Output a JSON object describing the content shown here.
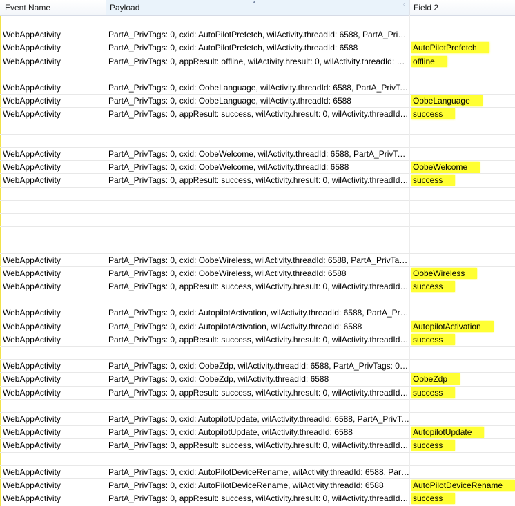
{
  "columns": {
    "event_name": "Event Name",
    "payload": "Payload",
    "field2": "Field 2"
  },
  "highlight_color": "#ffff33",
  "rows": [
    {
      "event": "",
      "payload": "",
      "field2": ""
    },
    {
      "event": "WebAppActivity",
      "payload": "PartA_PrivTags: 0, cxid: AutoPilotPrefetch, wilActivity.threadId: 6588, PartA_PrivT...",
      "field2": ""
    },
    {
      "event": "WebAppActivity",
      "payload": "PartA_PrivTags: 0, cxid: AutoPilotPrefetch, wilActivity.threadId: 6588",
      "field2": "AutoPilotPrefetch"
    },
    {
      "event": "WebAppActivity",
      "payload": "PartA_PrivTags: 0, appResult: offline, wilActivity.hresult: 0, wilActivity.threadId: 65...",
      "field2": "offline"
    },
    {
      "event": "",
      "payload": "",
      "field2": ""
    },
    {
      "event": "WebAppActivity",
      "payload": "PartA_PrivTags: 0, cxid: OobeLanguage, wilActivity.threadId: 6588, PartA_PrivTags:...",
      "field2": ""
    },
    {
      "event": "WebAppActivity",
      "payload": "PartA_PrivTags: 0, cxid: OobeLanguage, wilActivity.threadId: 6588",
      "field2": "OobeLanguage"
    },
    {
      "event": "WebAppActivity",
      "payload": "PartA_PrivTags: 0, appResult: success, wilActivity.hresult: 0, wilActivity.threadId: 6...",
      "field2": "success"
    },
    {
      "event": "",
      "payload": "",
      "field2": ""
    },
    {
      "event": "",
      "payload": "",
      "field2": ""
    },
    {
      "event": "WebAppActivity",
      "payload": "PartA_PrivTags: 0, cxid: OobeWelcome, wilActivity.threadId: 6588, PartA_PrivTags:...",
      "field2": ""
    },
    {
      "event": "WebAppActivity",
      "payload": "PartA_PrivTags: 0, cxid: OobeWelcome, wilActivity.threadId: 6588",
      "field2": "OobeWelcome"
    },
    {
      "event": "WebAppActivity",
      "payload": "PartA_PrivTags: 0, appResult: success, wilActivity.hresult: 0, wilActivity.threadId: 6...",
      "field2": "success"
    },
    {
      "event": "",
      "payload": "",
      "field2": ""
    },
    {
      "event": "",
      "payload": "",
      "field2": ""
    },
    {
      "event": "",
      "payload": "",
      "field2": ""
    },
    {
      "event": "",
      "payload": "",
      "field2": ""
    },
    {
      "event": "",
      "payload": "",
      "field2": ""
    },
    {
      "event": "WebAppActivity",
      "payload": "PartA_PrivTags: 0, cxid: OobeWireless, wilActivity.threadId: 6588, PartA_PrivTags:...",
      "field2": ""
    },
    {
      "event": "WebAppActivity",
      "payload": "PartA_PrivTags: 0, cxid: OobeWireless, wilActivity.threadId: 6588",
      "field2": "OobeWireless"
    },
    {
      "event": "WebAppActivity",
      "payload": "PartA_PrivTags: 0, appResult: success, wilActivity.hresult: 0, wilActivity.threadId: 6...",
      "field2": "success"
    },
    {
      "event": "",
      "payload": "",
      "field2": ""
    },
    {
      "event": "WebAppActivity",
      "payload": "PartA_PrivTags: 0, cxid: AutopilotActivation, wilActivity.threadId: 6588, PartA_Priv...",
      "field2": ""
    },
    {
      "event": "WebAppActivity",
      "payload": "PartA_PrivTags: 0, cxid: AutopilotActivation, wilActivity.threadId: 6588",
      "field2": "AutopilotActivation"
    },
    {
      "event": "WebAppActivity",
      "payload": "PartA_PrivTags: 0, appResult: success, wilActivity.hresult: 0, wilActivity.threadId: 6...",
      "field2": "success"
    },
    {
      "event": "",
      "payload": "",
      "field2": ""
    },
    {
      "event": "WebAppActivity",
      "payload": "PartA_PrivTags: 0, cxid: OobeZdp, wilActivity.threadId: 6588, PartA_PrivTags: 0, ap...",
      "field2": ""
    },
    {
      "event": "WebAppActivity",
      "payload": "PartA_PrivTags: 0, cxid: OobeZdp, wilActivity.threadId: 6588",
      "field2": "OobeZdp"
    },
    {
      "event": "WebAppActivity",
      "payload": "PartA_PrivTags: 0, appResult: success, wilActivity.hresult: 0, wilActivity.threadId: 6...",
      "field2": "success"
    },
    {
      "event": "",
      "payload": "",
      "field2": ""
    },
    {
      "event": "WebAppActivity",
      "payload": "PartA_PrivTags: 0, cxid: AutopilotUpdate, wilActivity.threadId: 6588, PartA_PrivTa...",
      "field2": ""
    },
    {
      "event": "WebAppActivity",
      "payload": "PartA_PrivTags: 0, cxid: AutopilotUpdate, wilActivity.threadId: 6588",
      "field2": "AutopilotUpdate"
    },
    {
      "event": "WebAppActivity",
      "payload": "PartA_PrivTags: 0, appResult: success, wilActivity.hresult: 0, wilActivity.threadId: 6...",
      "field2": "success"
    },
    {
      "event": "",
      "payload": "",
      "field2": ""
    },
    {
      "event": "WebAppActivity",
      "payload": "PartA_PrivTags: 0, cxid: AutoPilotDeviceRename, wilActivity.threadId: 6588, PartA...",
      "field2": ""
    },
    {
      "event": "WebAppActivity",
      "payload": "PartA_PrivTags: 0, cxid: AutoPilotDeviceRename, wilActivity.threadId: 6588",
      "field2": "AutoPilotDeviceRename"
    },
    {
      "event": "WebAppActivity",
      "payload": "PartA_PrivTags: 0, appResult: success, wilActivity.hresult: 0, wilActivity.threadId: 6...",
      "field2": "success"
    }
  ]
}
